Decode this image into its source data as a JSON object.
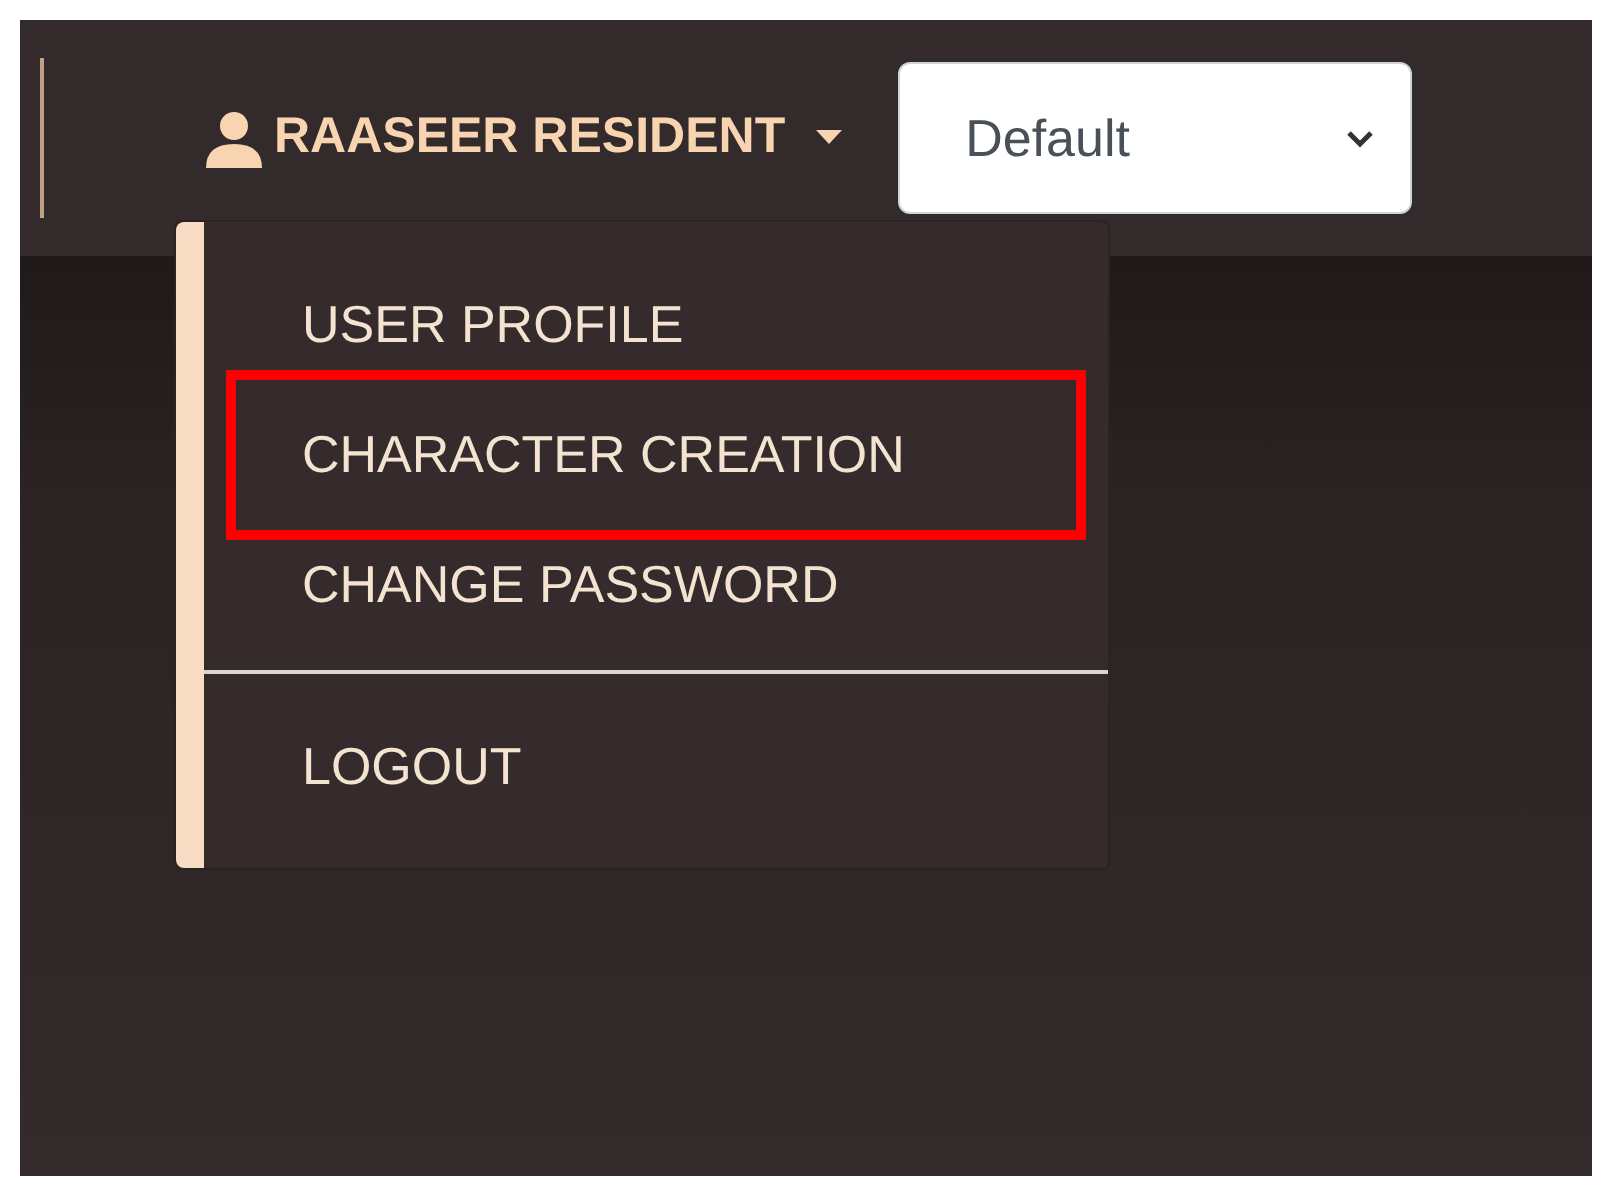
{
  "navbar": {
    "user_menu": {
      "label": "RAASEER RESIDENT",
      "expanded": true
    },
    "theme_select": {
      "value": "Default"
    }
  },
  "dropdown_groups": [
    {
      "items": [
        {
          "label": "USER PROFILE",
          "highlighted": false
        },
        {
          "label": "CHARACTER CREATION",
          "highlighted": true
        },
        {
          "label": "CHANGE PASSWORD",
          "highlighted": false
        }
      ]
    },
    {
      "items": [
        {
          "label": "LOGOUT",
          "highlighted": false
        }
      ]
    }
  ]
}
